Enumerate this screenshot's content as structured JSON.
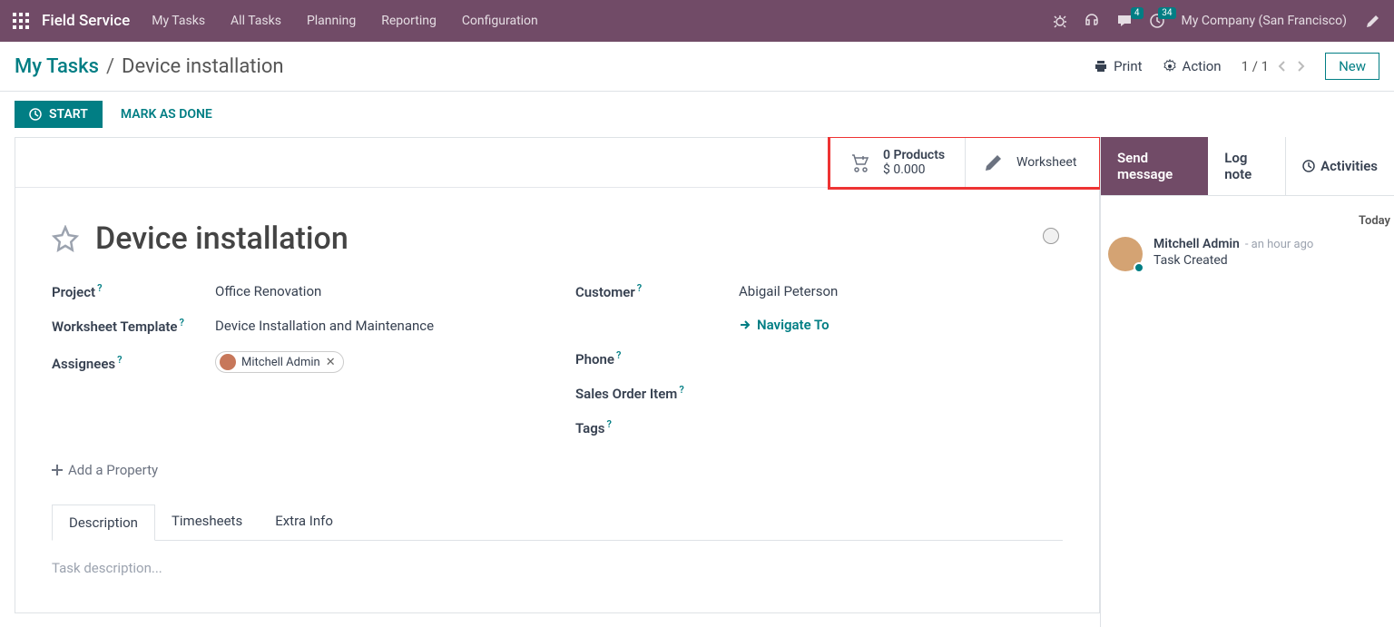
{
  "topnav": {
    "brand": "Field Service",
    "menu": [
      "My Tasks",
      "All Tasks",
      "Planning",
      "Reporting",
      "Configuration"
    ],
    "chat_badge": "4",
    "activity_badge": "34",
    "company": "My Company (San Francisco)"
  },
  "breadcrumb": {
    "parent": "My Tasks",
    "current": "Device installation"
  },
  "subheader": {
    "print": "Print",
    "action": "Action",
    "pager": "1 / 1",
    "new": "New"
  },
  "actionbar": {
    "start": "START",
    "mark_done": "MARK AS DONE"
  },
  "stats": {
    "products_line1": "0 Products",
    "products_line2": "$ 0.000",
    "worksheet": "Worksheet"
  },
  "task": {
    "title": "Device installation",
    "fields_left": {
      "project_label": "Project",
      "project_value": "Office Renovation",
      "template_label": "Worksheet Template",
      "template_value": "Device Installation and Maintenance",
      "assignees_label": "Assignees",
      "assignee_name": "Mitchell Admin"
    },
    "fields_right": {
      "customer_label": "Customer",
      "customer_value": "Abigail Peterson",
      "navigate": "Navigate To",
      "phone_label": "Phone",
      "soi_label": "Sales Order Item",
      "tags_label": "Tags"
    },
    "add_property": "Add a Property",
    "tabs": [
      "Description",
      "Timesheets",
      "Extra Info"
    ],
    "desc_placeholder": "Task description..."
  },
  "chatter": {
    "send": "Send message",
    "log": "Log note",
    "activities": "Activities",
    "today": "Today",
    "msg_author": "Mitchell Admin",
    "msg_time": "- an hour ago",
    "msg_text": "Task Created"
  }
}
